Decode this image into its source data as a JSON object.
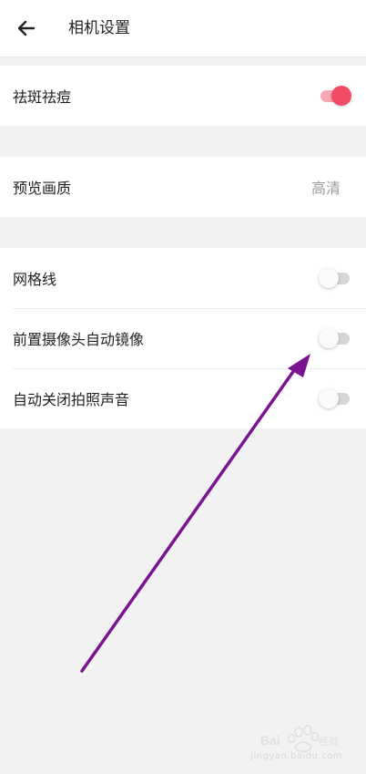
{
  "header": {
    "title": "相机设置",
    "back_icon": "arrow-left-icon"
  },
  "sections": [
    {
      "rows": [
        {
          "label": "祛斑祛痘",
          "control": "toggle",
          "on": true
        }
      ]
    },
    {
      "rows": [
        {
          "label": "预览画质",
          "control": "value",
          "value": "高清"
        }
      ]
    },
    {
      "rows": [
        {
          "label": "网格线",
          "control": "toggle",
          "on": false
        },
        {
          "label": "前置摄像头自动镜像",
          "control": "toggle",
          "on": false
        },
        {
          "label": "自动关闭拍照声音",
          "control": "toggle",
          "on": false
        }
      ]
    }
  ],
  "colors": {
    "accent": "#f24b66",
    "accent_track": "#f7a8b5",
    "annotation_arrow": "#7a1390",
    "background": "#f2f2f2",
    "card": "#ffffff",
    "secondary_text": "#9a9a9a"
  },
  "watermark": {
    "text": "Baidu 经验",
    "sub": "jingyan.baidu.com"
  }
}
